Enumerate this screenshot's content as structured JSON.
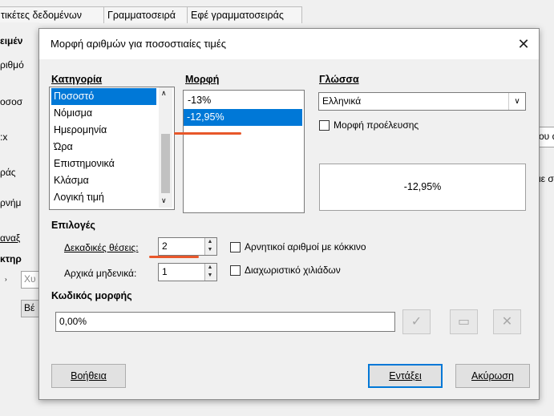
{
  "background": {
    "tabs": [
      "τικέτες δεδομένων",
      "Γραμματοσειρά",
      "Εφέ γραμματοσειράς"
    ],
    "side_fragments": [
      "ειμέν",
      "ριθμό",
      "οσοσ",
      ":x",
      "ράς",
      "ρνήμ",
      "αναξ",
      "κτηρ",
      "Χυ",
      "Βέ"
    ],
    "right_fragments": [
      "ου α",
      "ιε σι"
    ]
  },
  "dialog": {
    "title": "Μορφή αριθμών για ποσοστιαίες τιμές",
    "close_icon": "close-icon",
    "category": {
      "label": "Κατηγορία",
      "items": [
        "Ποσοστό",
        "Νόμισμα",
        "Ημερομηνία",
        "Ώρα",
        "Επιστημονικά",
        "Κλάσμα",
        "Λογική τιμή"
      ],
      "selected": "Ποσοστό"
    },
    "format": {
      "label": "Μορφή",
      "items": [
        "-13%",
        "-12,95%"
      ],
      "selected": "-12,95%"
    },
    "language": {
      "label": "Γλώσσα",
      "value": "Ελληνικά",
      "source_format_label": "Μορφή προέλευσης"
    },
    "preview_value": "-12,95%",
    "options": {
      "label": "Επιλογές",
      "decimal_places_label": "Δεκαδικές θέσεις:",
      "decimal_places_value": "2",
      "leading_zeros_label": "Αρχικά μηδενικά:",
      "leading_zeros_value": "1",
      "negative_red_label": "Αρνητικοί αριθμοί με κόκκινο",
      "thousands_sep_label": "Διαχωριστικό χιλιάδων"
    },
    "format_code": {
      "label": "Κωδικός μορφής",
      "value": "0,00%"
    },
    "buttons": {
      "help": "Βοήθεια",
      "ok": "Εντάξει",
      "cancel": "Ακύρωση"
    },
    "accent_color": "#0078d7",
    "annotation_color": "#e8572a"
  }
}
